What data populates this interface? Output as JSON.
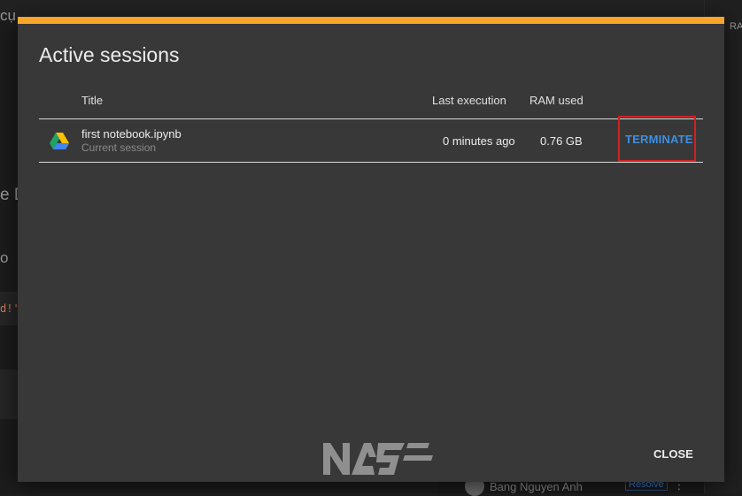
{
  "background": {
    "fragment_top_left": "cụ",
    "fragment_mid_left": "e D",
    "fragment_lower_left": "o",
    "fragment_code": "d!'",
    "fragment_top_right": "RA",
    "user_name": "Bang Nguyen Anh",
    "resolve_label": "Resolve",
    "kebab": "⋮"
  },
  "dialog": {
    "accent_color": "#f8a52a",
    "title": "Active sessions",
    "columns": {
      "title": "Title",
      "last_execution": "Last execution",
      "ram_used": "RAM used"
    },
    "sessions": [
      {
        "icon": "google-drive-icon",
        "title": "first notebook.ipynb",
        "subtitle": "Current session",
        "last_execution": "0 minutes ago",
        "ram_used": "0.76 GB",
        "action_label": "TERMINATE"
      }
    ],
    "close_label": "CLOSE"
  }
}
